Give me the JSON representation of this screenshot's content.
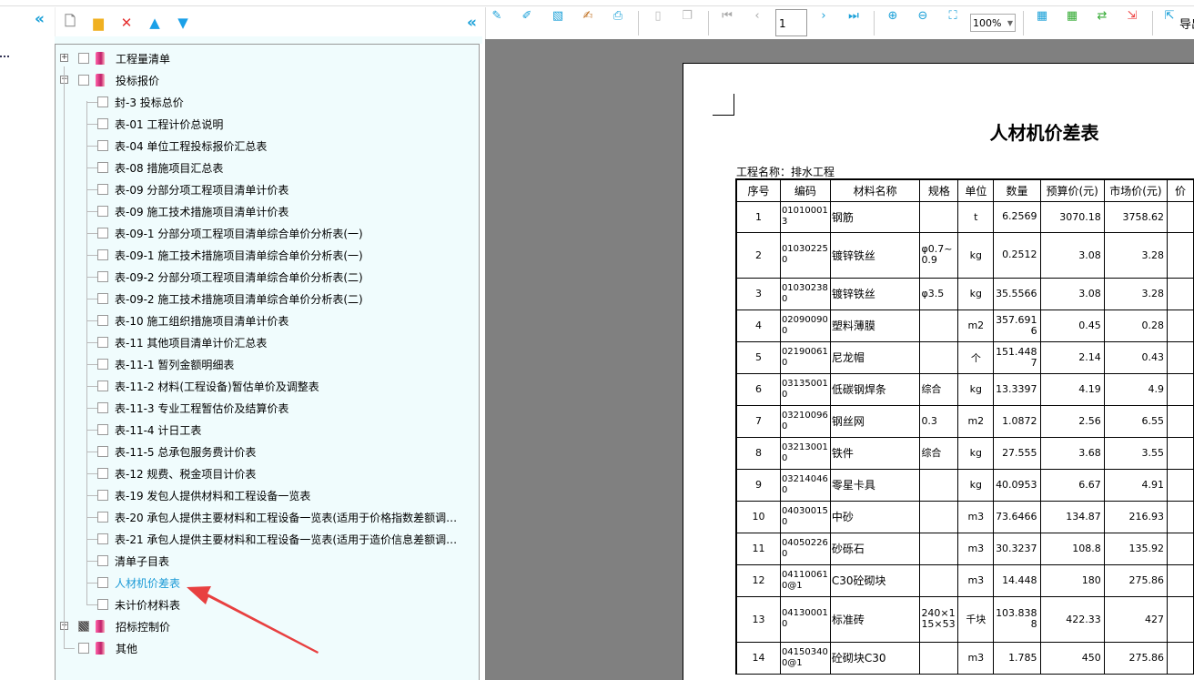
{
  "left_toolbar": {
    "icons": [
      "new-file-icon",
      "new-folder-icon",
      "delete-icon",
      "move-up-icon",
      "move-down-icon"
    ]
  },
  "tree": [
    {
      "label": "工程量清单",
      "level": 0,
      "expand": "+",
      "state": "none"
    },
    {
      "label": "投标报价",
      "level": 0,
      "expand": "-",
      "state": "none"
    },
    {
      "label": "封-3 投标总价",
      "level": 1
    },
    {
      "label": "表-01 工程计价总说明",
      "level": 1
    },
    {
      "label": "表-04 单位工程投标报价汇总表",
      "level": 1
    },
    {
      "label": "表-08 措施项目汇总表",
      "level": 1
    },
    {
      "label": "表-09 分部分项工程项目清单计价表",
      "level": 1
    },
    {
      "label": "表-09 施工技术措施项目清单计价表",
      "level": 1
    },
    {
      "label": "表-09-1 分部分项工程项目清单综合单价分析表(一)",
      "level": 1
    },
    {
      "label": "表-09-1 施工技术措施项目清单综合单价分析表(一)",
      "level": 1
    },
    {
      "label": "表-09-2 分部分项工程项目清单综合单价分析表(二)",
      "level": 1
    },
    {
      "label": "表-09-2 施工技术措施项目清单综合单价分析表(二)",
      "level": 1
    },
    {
      "label": "表-10 施工组织措施项目清单计价表",
      "level": 1
    },
    {
      "label": "表-11 其他项目清单计价汇总表",
      "level": 1
    },
    {
      "label": "表-11-1 暂列金额明细表",
      "level": 1
    },
    {
      "label": "表-11-2 材料(工程设备)暂估单价及调整表",
      "level": 1
    },
    {
      "label": "表-11-3 专业工程暂估价及结算价表",
      "level": 1
    },
    {
      "label": "表-11-4 计日工表",
      "level": 1
    },
    {
      "label": "表-11-5 总承包服务费计价表",
      "level": 1
    },
    {
      "label": "表-12 规费、税金项目计价表",
      "level": 1
    },
    {
      "label": "表-19 发包人提供材料和工程设备一览表",
      "level": 1
    },
    {
      "label": "表-20 承包人提供主要材料和工程设备一览表(适用于价格指数差额调…",
      "level": 1
    },
    {
      "label": "表-21 承包人提供主要材料和工程设备一览表(适用于造价信息差额调…",
      "level": 1
    },
    {
      "label": "清单子目表",
      "level": 1
    },
    {
      "label": "人材机价差表",
      "level": 1,
      "selected": true
    },
    {
      "label": "未计价材料表",
      "level": 1
    },
    {
      "label": "招标控制价",
      "level": 0,
      "expand": "+",
      "state": "partial"
    },
    {
      "label": "其他",
      "level": 0,
      "state": "none"
    }
  ],
  "viewer_toolbar": {
    "page": "1",
    "zoom": "100%",
    "export_label": "导出"
  },
  "report": {
    "title": "人材机价差表",
    "project_label": "工程名称：排水工程",
    "columns": [
      "序号",
      "编码",
      "材料名称",
      "规格",
      "单位",
      "数量",
      "预算价(元)",
      "市场价(元)",
      "价"
    ],
    "rows": [
      [
        "1",
        "010100013",
        "钢筋",
        "",
        "t",
        "6.2569",
        "3070.18",
        "3758.62"
      ],
      [
        "2",
        "010302250",
        "镀锌铁丝",
        "φ0.7~0.9",
        "kg",
        "0.2512",
        "3.08",
        "3.28"
      ],
      [
        "3",
        "010302380",
        "镀锌铁丝",
        "φ3.5",
        "kg",
        "35.5566",
        "3.08",
        "3.28"
      ],
      [
        "4",
        "020900900",
        "塑料薄膜",
        "",
        "m2",
        "357.6916",
        "0.45",
        "0.28"
      ],
      [
        "5",
        "021900610",
        "尼龙帽",
        "",
        "个",
        "151.4487",
        "2.14",
        "0.43"
      ],
      [
        "6",
        "031350010",
        "低碳钢焊条",
        "综合",
        "kg",
        "13.3397",
        "4.19",
        "4.9"
      ],
      [
        "7",
        "032100960",
        "钢丝网",
        "0.3",
        "m2",
        "1.0872",
        "2.56",
        "6.55"
      ],
      [
        "8",
        "032130010",
        "铁件",
        "综合",
        "kg",
        "27.555",
        "3.68",
        "3.55"
      ],
      [
        "9",
        "032140460",
        "零星卡具",
        "",
        "kg",
        "40.0953",
        "6.67",
        "4.91"
      ],
      [
        "10",
        "040300150",
        "中砂",
        "",
        "m3",
        "73.6466",
        "134.87",
        "216.93"
      ],
      [
        "11",
        "040502260",
        "砂砾石",
        "",
        "m3",
        "30.3237",
        "108.8",
        "135.92"
      ],
      [
        "12",
        "041100610@1",
        "C30砼砌块",
        "",
        "m3",
        "14.448",
        "180",
        "275.86"
      ],
      [
        "13",
        "041300010",
        "标准砖",
        "240×115×53",
        "千块",
        "103.8388",
        "422.33",
        "427"
      ],
      [
        "14",
        "041503400@1",
        "砼砌块C30",
        "",
        "m3",
        "1.785",
        "450",
        "275.86"
      ]
    ]
  },
  "colors": {
    "accent": "#1b9ad6",
    "tree_bg": "#f0fcfd",
    "arrow": "#e84040",
    "viewer_bg": "#808080"
  }
}
